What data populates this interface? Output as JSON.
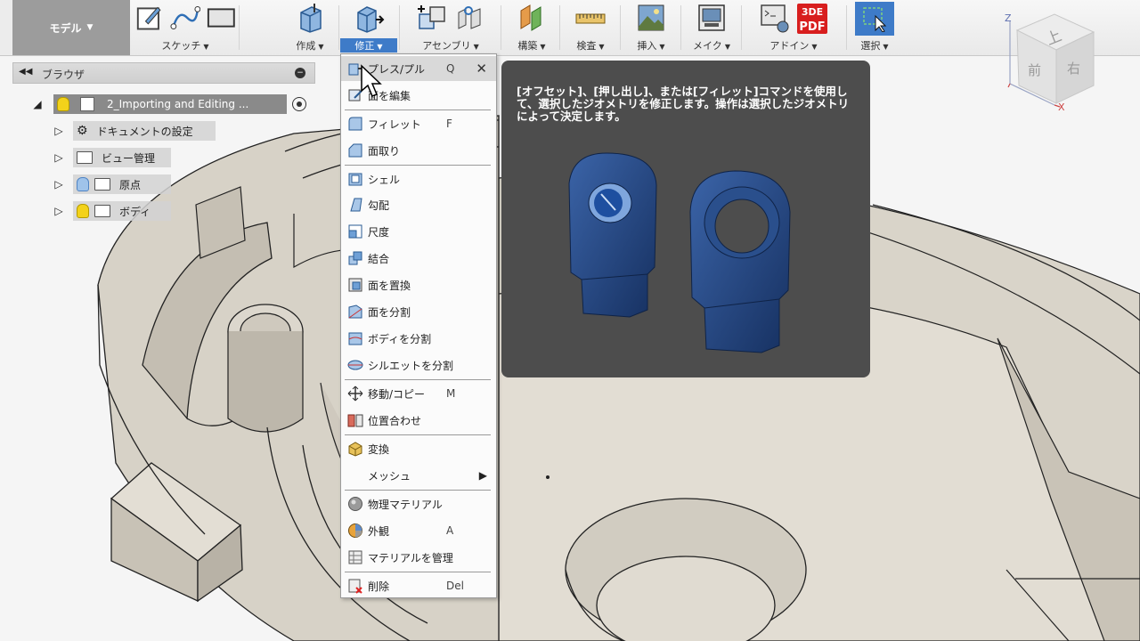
{
  "ribbon": {
    "workspace": "モデル",
    "groups": [
      {
        "label": "スケッチ"
      },
      {
        "label": "作成"
      },
      {
        "label": "修正"
      },
      {
        "label": "アセンブリ"
      },
      {
        "label": "構築"
      },
      {
        "label": "検査"
      },
      {
        "label": "挿入"
      },
      {
        "label": "メイク"
      },
      {
        "label": "アドイン"
      },
      {
        "label": "選択"
      }
    ],
    "active_group": "修正",
    "pdf_badge_text": "PDF",
    "pdf_badge_prefix": "3DE"
  },
  "viewcube": {
    "top_face": "上",
    "front_face": "前",
    "right_face": "右",
    "axis_z": "Z",
    "axis_x": "X"
  },
  "browser": {
    "title": "ブラウザ",
    "root": "2_Importing and Editing ...",
    "items": [
      {
        "label": "ドキュメントの設定",
        "icon": "gear-icon"
      },
      {
        "label": "ビュー管理",
        "icon": "folder-icon"
      },
      {
        "label": "原点",
        "icon": "folder-icon",
        "bulb": "off"
      },
      {
        "label": "ボディ",
        "icon": "folder-icon",
        "bulb": "on"
      }
    ]
  },
  "menu": {
    "items": [
      {
        "label": "プレス/プル",
        "key": "Q",
        "icon": "press-pull-icon"
      },
      {
        "label": "面を編集",
        "key": "",
        "icon": "edit-face-icon"
      },
      {
        "label": "フィレット",
        "key": "F",
        "icon": "fillet-icon"
      },
      {
        "label": "面取り",
        "key": "",
        "icon": "chamfer-icon"
      },
      {
        "label": "シェル",
        "key": "",
        "icon": "shell-icon"
      },
      {
        "label": "勾配",
        "key": "",
        "icon": "draft-icon"
      },
      {
        "label": "尺度",
        "key": "",
        "icon": "scale-icon"
      },
      {
        "label": "結合",
        "key": "",
        "icon": "combine-icon"
      },
      {
        "label": "面を置換",
        "key": "",
        "icon": "replace-face-icon"
      },
      {
        "label": "面を分割",
        "key": "",
        "icon": "split-face-icon"
      },
      {
        "label": "ボディを分割",
        "key": "",
        "icon": "split-body-icon"
      },
      {
        "label": "シルエットを分割",
        "key": "",
        "icon": "silhouette-split-icon"
      },
      {
        "label": "移動/コピー",
        "key": "M",
        "icon": "move-icon"
      },
      {
        "label": "位置合わせ",
        "key": "",
        "icon": "align-icon"
      },
      {
        "label": "変換",
        "key": "",
        "icon": "convert-icon"
      },
      {
        "label": "メッシュ",
        "key": "",
        "icon": ""
      },
      {
        "label": "物理マテリアル",
        "key": "",
        "icon": "physical-material-icon"
      },
      {
        "label": "外観",
        "key": "A",
        "icon": "appearance-icon"
      },
      {
        "label": "マテリアルを管理",
        "key": "",
        "icon": "manage-materials-icon"
      },
      {
        "label": "削除",
        "key": "Del",
        "icon": "delete-icon"
      }
    ]
  },
  "tooltip": {
    "text": "[オフセット]、[押し出し]、または[フィレット]コマンドを使用して、選択したジオメトリを修正します。操作は選択したジオメトリによって決定します。"
  },
  "colors": {
    "accent": "#3e7bc8",
    "part_fill": "#d8d3c8",
    "part_dark": "#b9b3a6",
    "tooltip_bg": "#4d4d4d",
    "workspace_bg": "#9c9c9c"
  }
}
